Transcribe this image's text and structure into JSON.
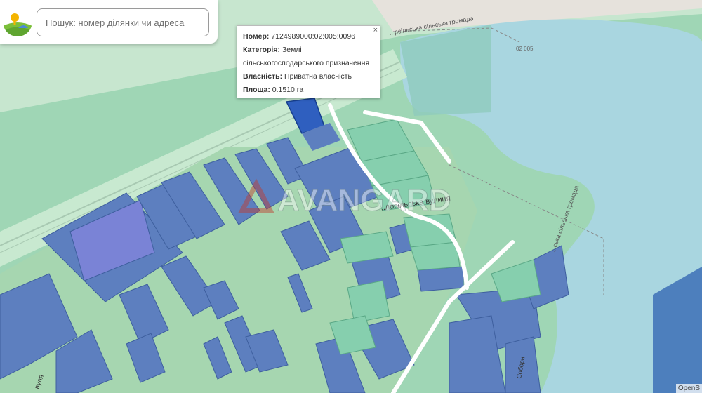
{
  "search": {
    "placeholder": "Пошук: номер ділянки чи адреса",
    "value": ""
  },
  "popup": {
    "number_label": "Номер:",
    "number_value": "7124989000:02:005:0096",
    "category_label": "Категорія:",
    "category_value_line1": "Землі",
    "category_value_line2": "сільськогосподарського призначення",
    "ownership_label": "Власність:",
    "ownership_value": "Приватна власність",
    "area_label": "Площа:",
    "area_value": "0.1510 га",
    "close_symbol": "×"
  },
  "map_labels": {
    "hromada_top": "...рсільська сільська громада",
    "street_main": "...лосільська вулиця",
    "hromada_right": "...ська сільська громада",
    "code_near_lake": "02 005",
    "street_bottom_left": "вуля",
    "street_bottom_right": "Соборн"
  },
  "watermark": {
    "text": "AVANGARD"
  },
  "attribution": "OpenS",
  "colors": {
    "agricultural": "#8fd3b0",
    "private_parcel": "#5a7fc0",
    "selected_parcel": "#2f5fbf",
    "water": "#aad3df",
    "road": "#ffffff",
    "watermark": "#c0392b"
  },
  "icons": [
    "app-logo-icon",
    "close-icon"
  ]
}
